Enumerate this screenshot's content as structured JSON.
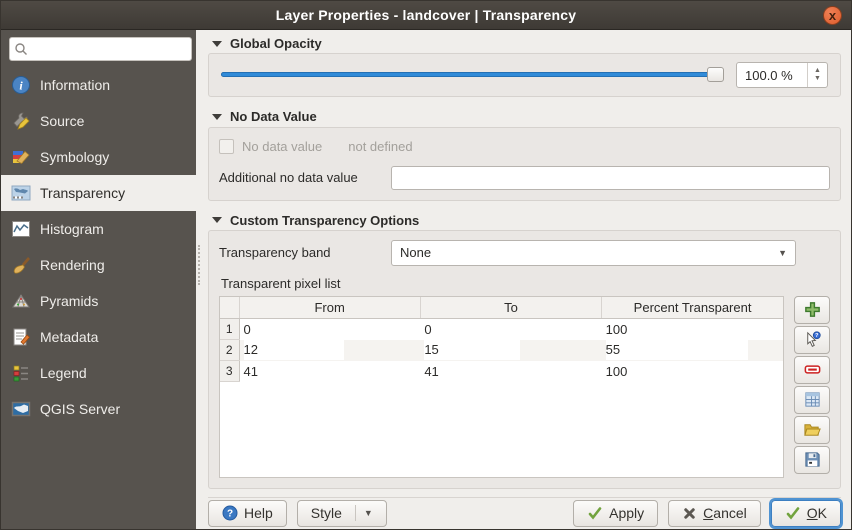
{
  "window": {
    "title": "Layer Properties - landcover | Transparency",
    "close_glyph": "x"
  },
  "colors": {
    "accent_blue": "#318bd8",
    "close_orange": "#dd5c2c",
    "sidebar_bg": "#57534e",
    "dialog_bg": "#f0eeeb"
  },
  "sidebar": {
    "search_placeholder": "",
    "items": [
      {
        "label": "Information",
        "icon": "information-icon",
        "selected": false
      },
      {
        "label": "Source",
        "icon": "source-icon",
        "selected": false
      },
      {
        "label": "Symbology",
        "icon": "symbology-icon",
        "selected": false
      },
      {
        "label": "Transparency",
        "icon": "transparency-icon",
        "selected": true
      },
      {
        "label": "Histogram",
        "icon": "histogram-icon",
        "selected": false
      },
      {
        "label": "Rendering",
        "icon": "rendering-icon",
        "selected": false
      },
      {
        "label": "Pyramids",
        "icon": "pyramids-icon",
        "selected": false
      },
      {
        "label": "Metadata",
        "icon": "metadata-icon",
        "selected": false
      },
      {
        "label": "Legend",
        "icon": "legend-icon",
        "selected": false
      },
      {
        "label": "QGIS Server",
        "icon": "qgis-server-icon",
        "selected": false
      }
    ]
  },
  "global_opacity": {
    "title": "Global Opacity",
    "slider_percent": 100,
    "value": "100.0 %"
  },
  "no_data_value": {
    "title": "No Data Value",
    "checkbox_label": "No data value",
    "checkbox_checked": false,
    "status_text": "not defined",
    "additional_label": "Additional no data value",
    "additional_value": ""
  },
  "custom_transparency": {
    "title": "Custom Transparency Options",
    "band_label": "Transparency band",
    "band_selected": "None",
    "pixel_list_label": "Transparent pixel list",
    "table": {
      "columns": [
        "From",
        "To",
        "Percent Transparent"
      ],
      "rows": [
        {
          "num": "1",
          "from": "0",
          "to": "0",
          "percent": "100"
        },
        {
          "num": "2",
          "from": "12",
          "to": "15",
          "percent": "55"
        },
        {
          "num": "3",
          "from": "41",
          "to": "41",
          "percent": "100"
        }
      ]
    },
    "tools": [
      {
        "icon": "plus-icon"
      },
      {
        "icon": "pointer-query-icon"
      },
      {
        "icon": "minus-icon"
      },
      {
        "icon": "table-grid-icon"
      },
      {
        "icon": "folder-open-icon"
      },
      {
        "icon": "save-icon"
      }
    ]
  },
  "footer": {
    "help": "Help",
    "style": "Style",
    "apply": "Apply",
    "cancel_accel": "C",
    "cancel_rest": "ancel",
    "ok_accel": "O",
    "ok_rest": "K"
  }
}
